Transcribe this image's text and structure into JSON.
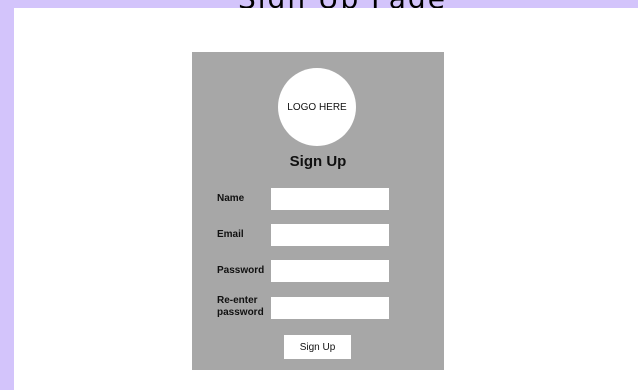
{
  "header_fragment": "Sign Up Page",
  "form": {
    "logo_text": "LOGO HERE",
    "title": "Sign Up",
    "fields": [
      {
        "label": "Name",
        "value": "",
        "placeholder": ""
      },
      {
        "label": "Email",
        "value": "",
        "placeholder": ""
      },
      {
        "label": "Password",
        "value": "",
        "placeholder": ""
      },
      {
        "label": "Re-enter password",
        "value": "",
        "placeholder": ""
      }
    ],
    "submit_label": "Sign Up"
  },
  "colors": {
    "frame": "#d3c4fb",
    "canvas": "#ffffff",
    "card": "#a7a7a7",
    "input": "#ffffff"
  }
}
